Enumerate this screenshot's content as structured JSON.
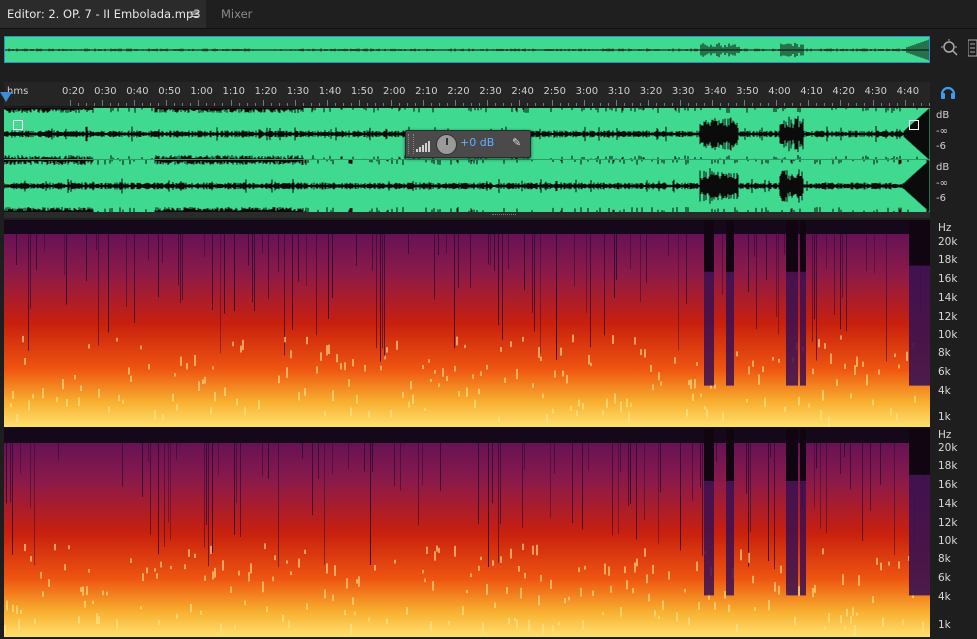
{
  "tabs": {
    "editor_label": "Editor: 2. OP. 7  -  II Embolada.mp3",
    "menu_glyph": "≡",
    "mixer_label": "Mixer"
  },
  "colors": {
    "waveform_fill": "#3fd98f",
    "waveform_trace": "#0b0b0b",
    "accent": "#2b8ecf",
    "gain_value": "#5fb0ff"
  },
  "ruler": {
    "unit_label": "hms",
    "ticks": [
      "0:20",
      "0:30",
      "0:40",
      "0:50",
      "1:00",
      "1:10",
      "1:20",
      "1:30",
      "1:40",
      "1:50",
      "2:00",
      "2:10",
      "2:20",
      "2:30",
      "2:40",
      "2:50",
      "3:00",
      "3:10",
      "3:20",
      "3:30",
      "3:40",
      "3:50",
      "4:00",
      "4:10",
      "4:20",
      "4:30",
      "4:40"
    ]
  },
  "hud": {
    "gain_value": "+0 dB"
  },
  "amplitude_scale": {
    "channels": [
      {
        "unit": "dB",
        "labels": [
          "-∞",
          "-6"
        ]
      },
      {
        "unit": "dB",
        "labels": [
          "-∞",
          "-6"
        ]
      }
    ]
  },
  "frequency_scale": {
    "channels": [
      {
        "unit": "Hz",
        "labels": [
          "20k",
          "18k",
          "16k",
          "14k",
          "12k",
          "10k",
          "8k",
          "6k",
          "4k",
          "1k"
        ]
      },
      {
        "unit": "Hz",
        "labels": [
          "20k",
          "18k",
          "16k",
          "14k",
          "12k",
          "10k",
          "8k",
          "6k",
          "4k",
          "1k"
        ]
      }
    ]
  },
  "icons": {
    "zoom": "zoom-icon",
    "panel_menu": "panel-menu-icon",
    "headphones": "headphones-icon",
    "volume": "volume-icon",
    "pin": "pin-icon"
  }
}
